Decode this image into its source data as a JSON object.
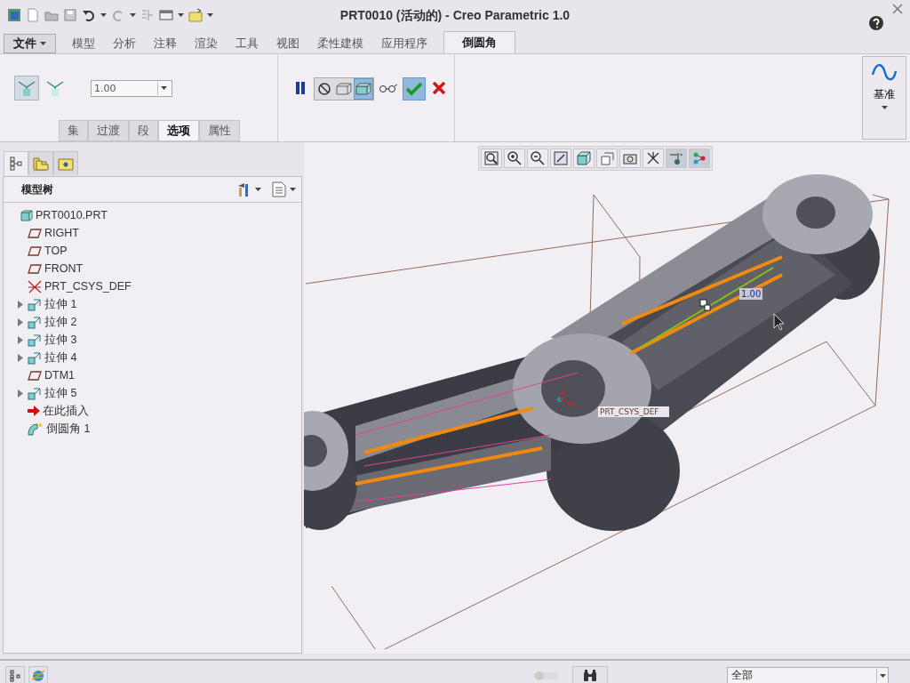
{
  "window": {
    "title": "PRT0010 (活动的) - Creo Parametric 1.0"
  },
  "ribbon_tabs": [
    {
      "label": "文件",
      "kind": "menu",
      "selected": false
    },
    {
      "label": "模型",
      "kind": "tab",
      "selected": false
    },
    {
      "label": "分析",
      "kind": "tab",
      "selected": false
    },
    {
      "label": "注释",
      "kind": "tab",
      "selected": false
    },
    {
      "label": "渲染",
      "kind": "tab",
      "selected": false
    },
    {
      "label": "工具",
      "kind": "tab",
      "selected": false
    },
    {
      "label": "视图",
      "kind": "tab",
      "selected": false
    },
    {
      "label": "柔性建模",
      "kind": "tab",
      "selected": false
    },
    {
      "label": "应用程序",
      "kind": "tab",
      "selected": false
    },
    {
      "label": "倒圆角",
      "kind": "tab",
      "selected": true
    }
  ],
  "round_tool": {
    "mode_buttons": [
      {
        "selected": true
      },
      {
        "selected": false
      }
    ],
    "radius": "1.00",
    "subtabs": [
      {
        "label": "集",
        "selected": false
      },
      {
        "label": "过渡",
        "selected": false
      },
      {
        "label": "段",
        "selected": false
      },
      {
        "label": "选项",
        "selected": true
      },
      {
        "label": "属性",
        "selected": false
      }
    ],
    "preview_on": true,
    "datum": {
      "label": "基准"
    }
  },
  "navigator_tabs": [
    {
      "selected": true
    },
    {
      "selected": false
    },
    {
      "selected": false
    }
  ],
  "model_tree": {
    "title": "模型树",
    "items": [
      {
        "label": "PRT0010.PRT",
        "kind": "part",
        "expandable": false,
        "indent": false
      },
      {
        "label": "RIGHT",
        "kind": "plane",
        "expandable": false,
        "indent": true
      },
      {
        "label": "TOP",
        "kind": "plane",
        "expandable": false,
        "indent": true
      },
      {
        "label": "FRONT",
        "kind": "plane",
        "expandable": false,
        "indent": true
      },
      {
        "label": "PRT_CSYS_DEF",
        "kind": "csys",
        "expandable": false,
        "indent": true
      },
      {
        "label": "拉伸 1",
        "kind": "extrude",
        "expandable": true,
        "indent": true
      },
      {
        "label": "拉伸 2",
        "kind": "extrude",
        "expandable": true,
        "indent": true
      },
      {
        "label": "拉伸 3",
        "kind": "extrude",
        "expandable": true,
        "indent": true
      },
      {
        "label": "拉伸 4",
        "kind": "extrude",
        "expandable": true,
        "indent": true
      },
      {
        "label": "DTM1",
        "kind": "plane",
        "expandable": false,
        "indent": true
      },
      {
        "label": "拉伸 5",
        "kind": "extrude",
        "expandable": true,
        "indent": true
      },
      {
        "label": "在此插入",
        "kind": "insert",
        "expandable": false,
        "indent": true
      },
      {
        "label": "倒圆角 1",
        "kind": "round",
        "expandable": false,
        "indent": true
      }
    ]
  },
  "viewport": {
    "dimension": "1.00",
    "csys_label": "PRT_CSYS_DEF"
  },
  "status_bar": {
    "filter": "全部"
  }
}
